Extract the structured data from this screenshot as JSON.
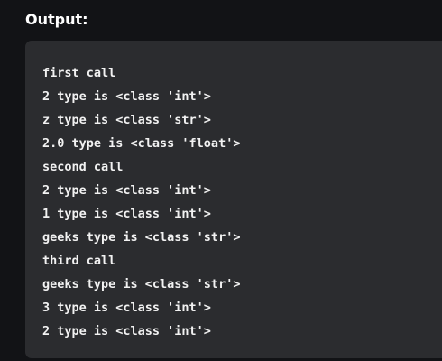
{
  "heading": "Output:",
  "output_lines": [
    "first call",
    "2 type is <class 'int'>",
    "z type is <class 'str'>",
    "2.0 type is <class 'float'>",
    "second call",
    "2 type is <class 'int'>",
    "1 type is <class 'int'>",
    "geeks type is <class 'str'>",
    "third call",
    "geeks type is <class 'str'>",
    "3 type is <class 'int'>",
    "2 type is <class 'int'>"
  ]
}
